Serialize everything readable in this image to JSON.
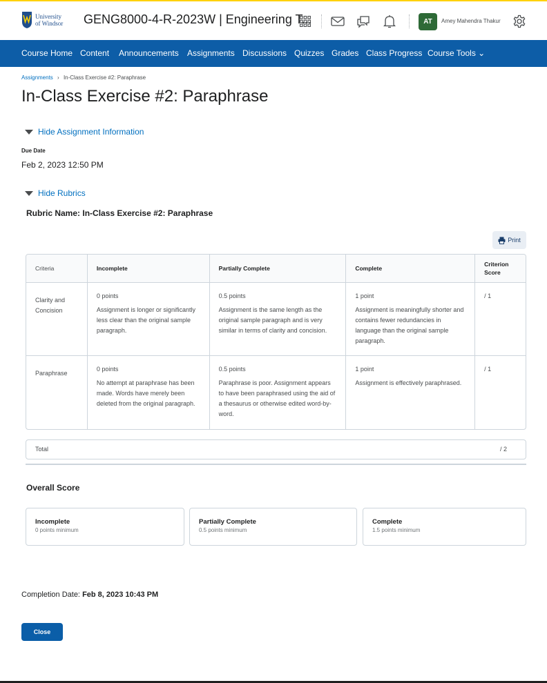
{
  "header": {
    "logo_text_line1": "University",
    "logo_text_line2": "of Windsor",
    "course_title": "GENG8000-4-R-2023W | Engineering T...",
    "user_initials": "AT",
    "user_name": "Amey Mahendra Thakur",
    "icons": [
      "apps-grid-icon",
      "mail-icon",
      "chat-icon",
      "bell-icon",
      "gear-icon"
    ]
  },
  "nav": {
    "items": [
      "Course Home",
      "Content",
      "Announcements",
      "Assignments",
      "Discussions",
      "Quizzes",
      "Grades",
      "Class Progress",
      "Course Tools"
    ],
    "course_tools_suffix": "⌄"
  },
  "breadcrumb": {
    "link": "Assignments",
    "separator": "›",
    "current": "In-Class Exercise #2: Paraphrase"
  },
  "page_title": "In-Class Exercise #2: Paraphrase",
  "assignment_info": {
    "toggle_label": "Hide Assignment Information",
    "due_label": "Due Date",
    "due_value": "Feb 2, 2023 12:50 PM"
  },
  "rubrics": {
    "toggle_label": "Hide Rubrics",
    "rubric_name_label": "Rubric Name:",
    "rubric_name": "In-Class Exercise #2: Paraphrase",
    "print_label": "Print",
    "headers": [
      "Criteria",
      "Incomplete",
      "Partially Complete",
      "Complete",
      "Criterion Score"
    ],
    "rows": [
      {
        "criterion": "Clarity and Concision",
        "levels": [
          {
            "points": "0 points",
            "desc": "Assignment is longer or significantly less clear than the original sample paragraph."
          },
          {
            "points": "0.5 points",
            "desc": "Assignment is the same length as the original sample paragraph and is very similar in terms of clarity and concision."
          },
          {
            "points": "1 point",
            "desc": "Assignment is meaningfully shorter and contains fewer redundancies in language than the original sample paragraph."
          }
        ],
        "score": "/ 1"
      },
      {
        "criterion": "Paraphrase",
        "levels": [
          {
            "points": "0 points",
            "desc": "No attempt at paraphrase has been made. Words have merely been deleted from the original paragraph."
          },
          {
            "points": "0.5 points",
            "desc": "Paraphrase is poor. Assignment appears to have been paraphrased using the aid of a thesaurus or otherwise edited word-by-word."
          },
          {
            "points": "1 point",
            "desc": "Assignment is effectively paraphrased."
          }
        ],
        "score": "/ 1"
      }
    ],
    "total_label": "Total",
    "total_value": "/ 2"
  },
  "overall_score": {
    "title": "Overall Score",
    "levels": [
      {
        "name": "Incomplete",
        "minimum": "0 points minimum"
      },
      {
        "name": "Partially Complete",
        "minimum": "0.5 points minimum"
      },
      {
        "name": "Complete",
        "minimum": "1.5 points minimum"
      }
    ]
  },
  "completion": {
    "label": "Completion Date:",
    "value": "Feb 8, 2023 10:43 PM"
  },
  "close_label": "Close",
  "colors": {
    "accent_yellow": "#ffd100",
    "nav_blue": "#0d5da7",
    "link_blue": "#006fbf",
    "avatar_green": "#2e6a37",
    "border": "#cdd5dc"
  }
}
